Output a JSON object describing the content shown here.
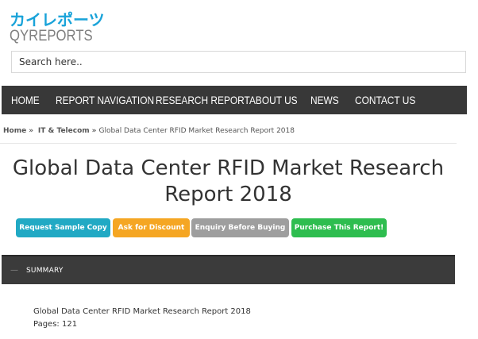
{
  "logo": {
    "jp_text": "カイレポーツ",
    "en_text": "QYREPORTS"
  },
  "search": {
    "placeholder": "Search here.."
  },
  "nav": {
    "items": [
      {
        "label": "HOME"
      },
      {
        "label": "REPORT NAVIGATION"
      },
      {
        "label": "RESEARCH REPORT"
      },
      {
        "label": "ABOUT US"
      },
      {
        "label": "NEWS"
      },
      {
        "label": "CONTACT US"
      }
    ]
  },
  "breadcrumb": {
    "home": "Home",
    "category": "IT & Telecom",
    "separator": "»",
    "current": "Global Data Center RFID Market Research Report 2018"
  },
  "page": {
    "title": "Global Data Center RFID Market Research Report 2018"
  },
  "buttons": {
    "sample": "Request Sample Copy",
    "discount": "Ask for Discount",
    "enquiry": "Enquiry Before Buying",
    "purchase": "Purchase This Report!"
  },
  "summary": {
    "toggle": "—",
    "label": "SUMMARY"
  },
  "content": {
    "report_name": "Global Data Center RFID Market Research Report 2018",
    "pages": "Pages: 121"
  },
  "colors": {
    "nav_bg": "#383838",
    "logo_accent": "#1aa3d9",
    "sample_btn": "#21a9c4",
    "discount_btn": "#f5a623",
    "enquiry_btn": "#9e9e9e",
    "purchase_btn": "#2ebd4f"
  }
}
